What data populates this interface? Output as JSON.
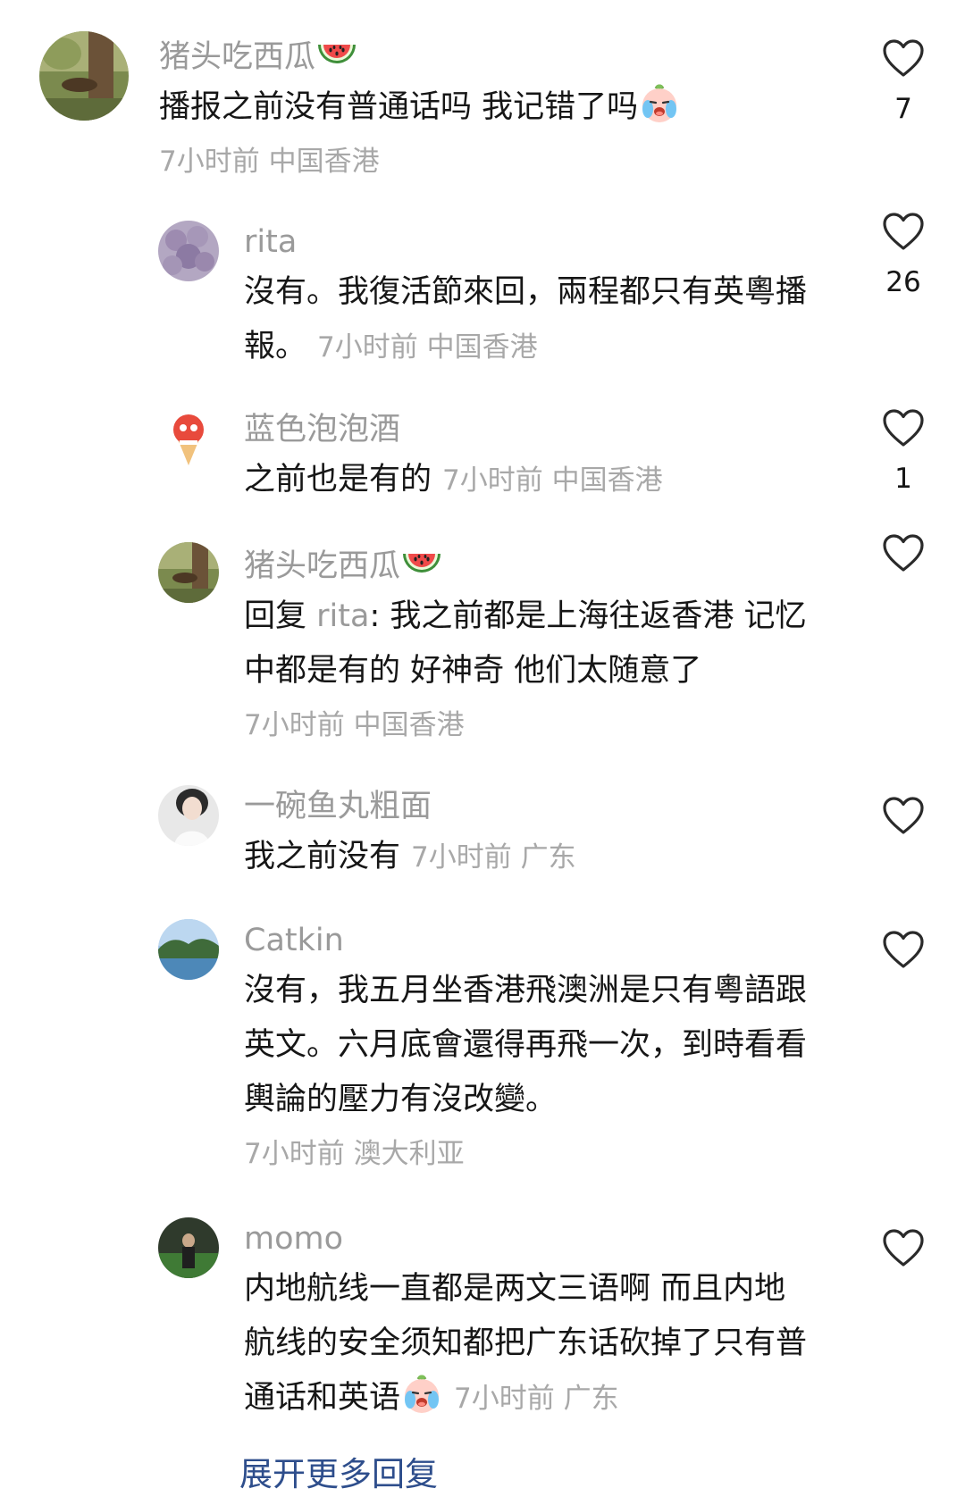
{
  "comments": [
    {
      "username": "猪头吃西瓜",
      "username_emoji": "watermelon-emoji",
      "text": "播报之前没有普通话吗 我记错了吗",
      "text_emoji": "crying-face-emoji",
      "time": "7小时前",
      "location": "中国香港",
      "likes": "7"
    },
    {
      "username": "rita",
      "text": "沒有。我復活節來回，兩程都只有英粵播報。",
      "time": "7小时前",
      "location": "中国香港",
      "likes": "26"
    },
    {
      "username": "蓝色泡泡酒",
      "text": "之前也是有的",
      "time": "7小时前",
      "location": "中国香港",
      "likes": "1"
    },
    {
      "username": "猪头吃西瓜",
      "username_emoji": "watermelon-emoji",
      "reply_prefix": "回复 ",
      "reply_target": "rita",
      "text": ": 我之前都是上海往返香港 记忆中都是有的 好神奇 他们太随意了",
      "time": "7小时前",
      "location": "中国香港",
      "likes": ""
    },
    {
      "username": "一碗鱼丸粗面",
      "text": "我之前没有",
      "time": "7小时前",
      "location": "广东",
      "likes": ""
    },
    {
      "username": "Catkin",
      "text": "沒有，我五月坐香港飛澳洲是只有粵語跟英文。六月底會還得再飛一次，到時看看輿論的壓力有沒改變。",
      "time": "7小时前",
      "location": "澳大利亚",
      "likes": ""
    },
    {
      "username": "momo",
      "text": "内地航线一直都是两文三语啊 而且内地航线的安全须知都把广东话砍掉了只有普通话和英语",
      "text_emoji": "crying-face-emoji",
      "time": "7小时前",
      "location": "广东",
      "likes": ""
    }
  ],
  "footer": {
    "more_replies": "展开更多回复"
  },
  "colors": {
    "username": "#9a9a9a",
    "text": "#161616",
    "meta": "#a8a8a8",
    "link": "#2e4e8c"
  }
}
